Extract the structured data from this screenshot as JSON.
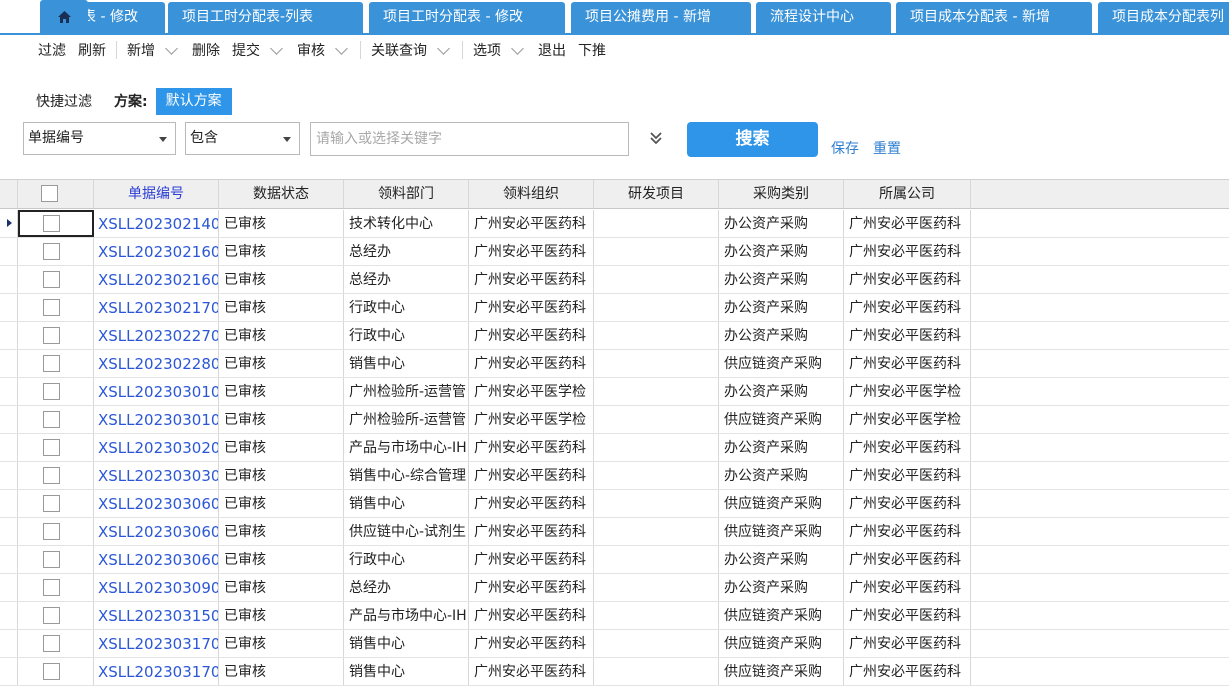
{
  "tabs": [
    {
      "label": "表 - 修改"
    },
    {
      "label": "项目工时分配表-列表"
    },
    {
      "label": "项目工时分配表 - 修改"
    },
    {
      "label": "项目公摊费用 - 新增"
    },
    {
      "label": "流程设计中心"
    },
    {
      "label": "项目成本分配表 - 新增"
    },
    {
      "label": "项目成本分配表列"
    }
  ],
  "home_icon": "home-icon",
  "toolbar": {
    "filter": "过滤",
    "refresh": "刷新",
    "add": "新增",
    "delete": "删除",
    "submit": "提交",
    "audit": "审核",
    "related_query": "关联查询",
    "options": "选项",
    "exit": "退出",
    "push_down": "下推"
  },
  "quick_filter": {
    "label": "快捷过滤",
    "scheme_label": "方案:",
    "scheme_value": "默认方案",
    "field_select": "单据编号",
    "op_select": "包含",
    "keyword_placeholder": "请输入或选择关键字",
    "search": "搜索",
    "save": "保存",
    "reset": "重置"
  },
  "grid": {
    "columns": [
      "单据编号",
      "数据状态",
      "领料部门",
      "领料组织",
      "研发项目",
      "采购类别",
      "所属公司"
    ],
    "rows": [
      {
        "no": "XSLL202302140",
        "status": "已审核",
        "dept": "技术转化中心",
        "org": "广州安必平医药科",
        "project": "",
        "category": "办公资产采购",
        "company": "广州安必平医药科"
      },
      {
        "no": "XSLL202302160",
        "status": "已审核",
        "dept": "总经办",
        "org": "广州安必平医药科",
        "project": "",
        "category": "办公资产采购",
        "company": "广州安必平医药科"
      },
      {
        "no": "XSLL202302160",
        "status": "已审核",
        "dept": "总经办",
        "org": "广州安必平医药科",
        "project": "",
        "category": "办公资产采购",
        "company": "广州安必平医药科"
      },
      {
        "no": "XSLL202302170",
        "status": "已审核",
        "dept": "行政中心",
        "org": "广州安必平医药科",
        "project": "",
        "category": "办公资产采购",
        "company": "广州安必平医药科"
      },
      {
        "no": "XSLL202302270",
        "status": "已审核",
        "dept": "行政中心",
        "org": "广州安必平医药科",
        "project": "",
        "category": "办公资产采购",
        "company": "广州安必平医药科"
      },
      {
        "no": "XSLL202302280",
        "status": "已审核",
        "dept": "销售中心",
        "org": "广州安必平医药科",
        "project": "",
        "category": "供应链资产采购",
        "company": "广州安必平医药科"
      },
      {
        "no": "XSLL202303010",
        "status": "已审核",
        "dept": "广州检验所-运营管",
        "org": "广州安必平医学检",
        "project": "",
        "category": "办公资产采购",
        "company": "广州安必平医学检"
      },
      {
        "no": "XSLL202303010",
        "status": "已审核",
        "dept": "广州检验所-运营管",
        "org": "广州安必平医学检",
        "project": "",
        "category": "供应链资产采购",
        "company": "广州安必平医学检"
      },
      {
        "no": "XSLL202303020",
        "status": "已审核",
        "dept": "产品与市场中心-IH",
        "org": "广州安必平医药科",
        "project": "",
        "category": "办公资产采购",
        "company": "广州安必平医药科"
      },
      {
        "no": "XSLL202303030",
        "status": "已审核",
        "dept": "销售中心-综合管理",
        "org": "广州安必平医药科",
        "project": "",
        "category": "办公资产采购",
        "company": "广州安必平医药科"
      },
      {
        "no": "XSLL202303060",
        "status": "已审核",
        "dept": "销售中心",
        "org": "广州安必平医药科",
        "project": "",
        "category": "供应链资产采购",
        "company": "广州安必平医药科"
      },
      {
        "no": "XSLL202303060",
        "status": "已审核",
        "dept": "供应链中心-试剂生",
        "org": "广州安必平医药科",
        "project": "",
        "category": "供应链资产采购",
        "company": "广州安必平医药科"
      },
      {
        "no": "XSLL202303060",
        "status": "已审核",
        "dept": "行政中心",
        "org": "广州安必平医药科",
        "project": "",
        "category": "办公资产采购",
        "company": "广州安必平医药科"
      },
      {
        "no": "XSLL202303090",
        "status": "已审核",
        "dept": "总经办",
        "org": "广州安必平医药科",
        "project": "",
        "category": "办公资产采购",
        "company": "广州安必平医药科"
      },
      {
        "no": "XSLL202303150",
        "status": "已审核",
        "dept": "产品与市场中心-IH",
        "org": "广州安必平医药科",
        "project": "",
        "category": "供应链资产采购",
        "company": "广州安必平医药科"
      },
      {
        "no": "XSLL202303170",
        "status": "已审核",
        "dept": "销售中心",
        "org": "广州安必平医药科",
        "project": "",
        "category": "供应链资产采购",
        "company": "广州安必平医药科"
      },
      {
        "no": "XSLL202303170",
        "status": "已审核",
        "dept": "销售中心",
        "org": "广州安必平医药科",
        "project": "",
        "category": "供应链资产采购",
        "company": "广州安必平医药科"
      }
    ]
  }
}
